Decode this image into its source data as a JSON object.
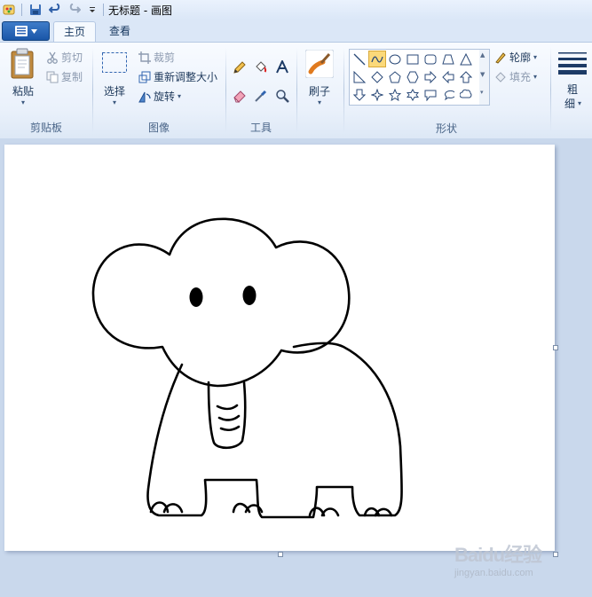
{
  "window": {
    "title": "无标题 - 画图"
  },
  "tabs": {
    "home": "主页",
    "view": "查看"
  },
  "ribbon": {
    "clipboard": {
      "paste": "粘贴",
      "cut": "剪切",
      "copy": "复制",
      "group": "剪贴板"
    },
    "image": {
      "select": "选择",
      "crop": "裁剪",
      "resize": "重新调整大小",
      "rotate": "旋转",
      "group": "图像"
    },
    "tools": {
      "group": "工具"
    },
    "brushes": {
      "label": "刷子"
    },
    "shapes": {
      "outline": "轮廓",
      "fill": "填充",
      "group": "形状"
    },
    "size": {
      "label_line1": "粗",
      "label_line2": "细"
    }
  },
  "watermark": {
    "brand": "Baidu经验",
    "url": "jingyan.baidu.com"
  },
  "colors": {
    "accent": "#2b63b5",
    "selected_shape": "#fbd97a"
  }
}
